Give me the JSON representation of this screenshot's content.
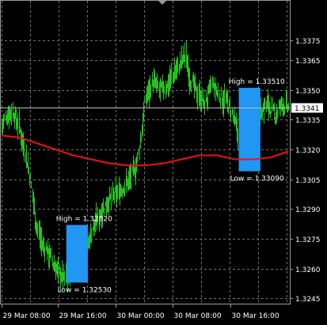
{
  "chart_data": {
    "type": "ohlc",
    "colors": {
      "background": "#000000",
      "grid": "#6f6f6f",
      "bars": "#22c51e",
      "moving_average": "#ee1111",
      "box": "#2196f3",
      "text": "#ffffff",
      "current_price_marker": "#ffffff",
      "current_price_text": "#000000"
    },
    "ylim": [
      1.3242,
      1.3392
    ],
    "y_ticks": [
      1.3375,
      1.3365,
      1.335,
      1.3335,
      1.332,
      1.3305,
      1.329,
      1.3275,
      1.326,
      1.3245
    ],
    "y_tick_labels": [
      "1.3375",
      "1.3365",
      "1.3350",
      "1.3335",
      "1.3320",
      "1.3305",
      "1.3290",
      "1.3275",
      "1.3260",
      "1.3245"
    ],
    "x_tick_labels": [
      {
        "bar": 0,
        "label": "29 Mar 08:00"
      },
      {
        "bar": 63,
        "label": "29 Mar 16:00"
      },
      {
        "bar": 127,
        "label": "30 Mar 00:00"
      },
      {
        "bar": 190,
        "label": "30 Mar 08:00"
      },
      {
        "bar": 255,
        "label": "30 Mar 16:00"
      }
    ],
    "bar_count": 320,
    "current_price": "1.3341",
    "price_path": [
      [
        0,
        1.3332
      ],
      [
        5,
        1.3337
      ],
      [
        12,
        1.3339
      ],
      [
        18,
        1.3333
      ],
      [
        25,
        1.3321
      ],
      [
        32,
        1.3305
      ],
      [
        38,
        1.3283
      ],
      [
        45,
        1.3272
      ],
      [
        52,
        1.3268
      ],
      [
        58,
        1.3262
      ],
      [
        63,
        1.3258
      ],
      [
        70,
        1.3255
      ],
      [
        78,
        1.3259
      ],
      [
        86,
        1.3262
      ],
      [
        94,
        1.327
      ],
      [
        102,
        1.3281
      ],
      [
        110,
        1.3288
      ],
      [
        118,
        1.3294
      ],
      [
        126,
        1.3297
      ],
      [
        134,
        1.33
      ],
      [
        142,
        1.3305
      ],
      [
        150,
        1.3312
      ],
      [
        156,
        1.333
      ],
      [
        160,
        1.3346
      ],
      [
        168,
        1.3354
      ],
      [
        176,
        1.335
      ],
      [
        184,
        1.3352
      ],
      [
        190,
        1.3357
      ],
      [
        197,
        1.3362
      ],
      [
        204,
        1.3368
      ],
      [
        210,
        1.3355
      ],
      [
        218,
        1.3348
      ],
      [
        226,
        1.3343
      ],
      [
        234,
        1.3353
      ],
      [
        242,
        1.3347
      ],
      [
        250,
        1.3344
      ],
      [
        256,
        1.3338
      ],
      [
        262,
        1.333
      ],
      [
        268,
        1.3317
      ],
      [
        274,
        1.3321
      ],
      [
        280,
        1.3335
      ],
      [
        288,
        1.3339
      ],
      [
        296,
        1.3343
      ],
      [
        304,
        1.3337
      ],
      [
        312,
        1.3343
      ],
      [
        319,
        1.3341
      ]
    ],
    "moving_average": [
      [
        0,
        1.3327
      ],
      [
        20,
        1.3326
      ],
      [
        40,
        1.3323
      ],
      [
        60,
        1.332
      ],
      [
        80,
        1.3317
      ],
      [
        100,
        1.3315
      ],
      [
        120,
        1.3313
      ],
      [
        140,
        1.3312
      ],
      [
        160,
        1.3312
      ],
      [
        180,
        1.3313
      ],
      [
        200,
        1.3315
      ],
      [
        220,
        1.3317
      ],
      [
        240,
        1.3317
      ],
      [
        260,
        1.3315
      ],
      [
        280,
        1.3315
      ],
      [
        300,
        1.3316
      ],
      [
        319,
        1.3319
      ]
    ],
    "boxes": [
      {
        "bar_start": 72,
        "bar_end": 96,
        "high": 1.3282,
        "low": 1.3253,
        "high_label": "High = 1.32820",
        "low_label": "Low = 1.32530"
      },
      {
        "bar_start": 264,
        "bar_end": 288,
        "high": 1.3351,
        "low": 1.3309,
        "high_label": "High = 1.33510",
        "low_label": "Low = 1.33090"
      }
    ]
  }
}
